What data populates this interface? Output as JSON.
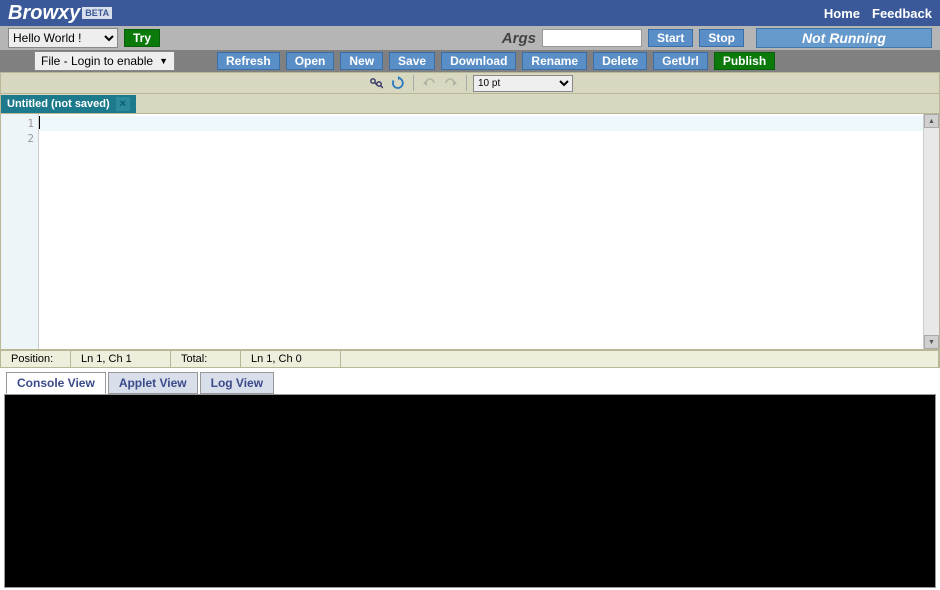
{
  "header": {
    "logo": "Browxy",
    "beta": "BETA",
    "links": {
      "home": "Home",
      "feedback": "Feedback"
    }
  },
  "toolbar1": {
    "project": "Hello World !",
    "try": "Try",
    "args_label": "Args",
    "args_value": "",
    "start": "Start",
    "stop": "Stop",
    "status": "Not Running"
  },
  "toolbar2": {
    "file_menu": "File - Login to enable",
    "buttons": {
      "refresh": "Refresh",
      "open": "Open",
      "new": "New",
      "save": "Save",
      "download": "Download",
      "rename": "Rename",
      "delete": "Delete",
      "geturl": "GetUrl",
      "publish": "Publish"
    }
  },
  "toolbar3": {
    "font_size": "10 pt"
  },
  "file_tab": {
    "title": "Untitled (not saved)"
  },
  "gutter": {
    "l1": "1",
    "l2": "2"
  },
  "status": {
    "pos_label": "Position:",
    "pos_val": "Ln 1, Ch 1",
    "tot_label": "Total:",
    "tot_val": "Ln 1, Ch 0"
  },
  "output_tabs": {
    "console": "Console View",
    "applet": "Applet View",
    "log": "Log View"
  }
}
